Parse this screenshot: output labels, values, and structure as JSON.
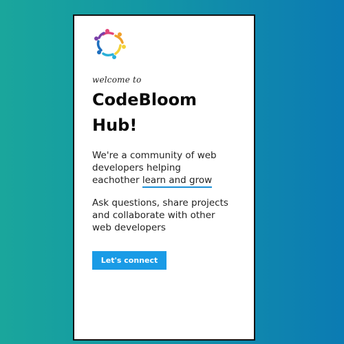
{
  "card": {
    "welcome": "welcome to",
    "title": "CodeBloom Hub!",
    "para1_prefix": "We're a community of web developers helping eachother ",
    "para1_highlight": "learn and grow",
    "para2": "Ask questions, share projects and collaborate with other web developers",
    "cta_label": "Let's connect"
  },
  "logo": {
    "icon": "people-circle-logo",
    "colors": [
      "#e2467a",
      "#f0a02a",
      "#f4d23a",
      "#2ab0d8",
      "#1e6fbf",
      "#7a3fa8"
    ]
  },
  "colors": {
    "accent": "#1a9be6",
    "underline": "#1a8fd8",
    "background_start": "#1aa69c",
    "background_end": "#0b7bb3"
  }
}
